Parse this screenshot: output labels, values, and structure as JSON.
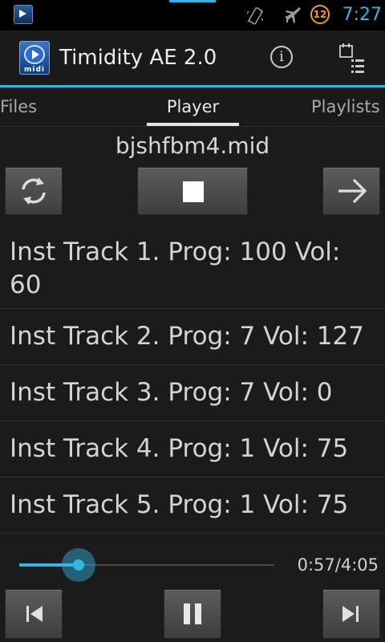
{
  "status_bar": {
    "time": "7:27",
    "badge": "12"
  },
  "app": {
    "title": "Timidity AE 2.0",
    "icon_label": "midi"
  },
  "tabs": [
    {
      "label": "Files"
    },
    {
      "label": "Player"
    },
    {
      "label": "Playlists"
    }
  ],
  "player": {
    "song": "bjshfbm4.mid",
    "tracks": [
      "Inst Track 1. Prog: 100 Vol: 60",
      "Inst Track 2. Prog: 7 Vol: 127",
      "Inst Track 3. Prog: 7 Vol: 0",
      "Inst Track 4. Prog: 1 Vol: 75",
      "Inst Track 5. Prog: 1 Vol: 75"
    ],
    "time_label": "0:57/4:05",
    "progress_fraction": 0.233
  },
  "colors": {
    "accent": "#33b5e5",
    "badge": "#f0a000"
  },
  "icons": [
    "app-icon",
    "info-icon",
    "overflow-menu-icon",
    "repeat-icon",
    "stop-icon",
    "arrow-right-icon",
    "previous-icon",
    "pause-icon",
    "next-icon",
    "vibrate-icon",
    "airplane-icon"
  ]
}
